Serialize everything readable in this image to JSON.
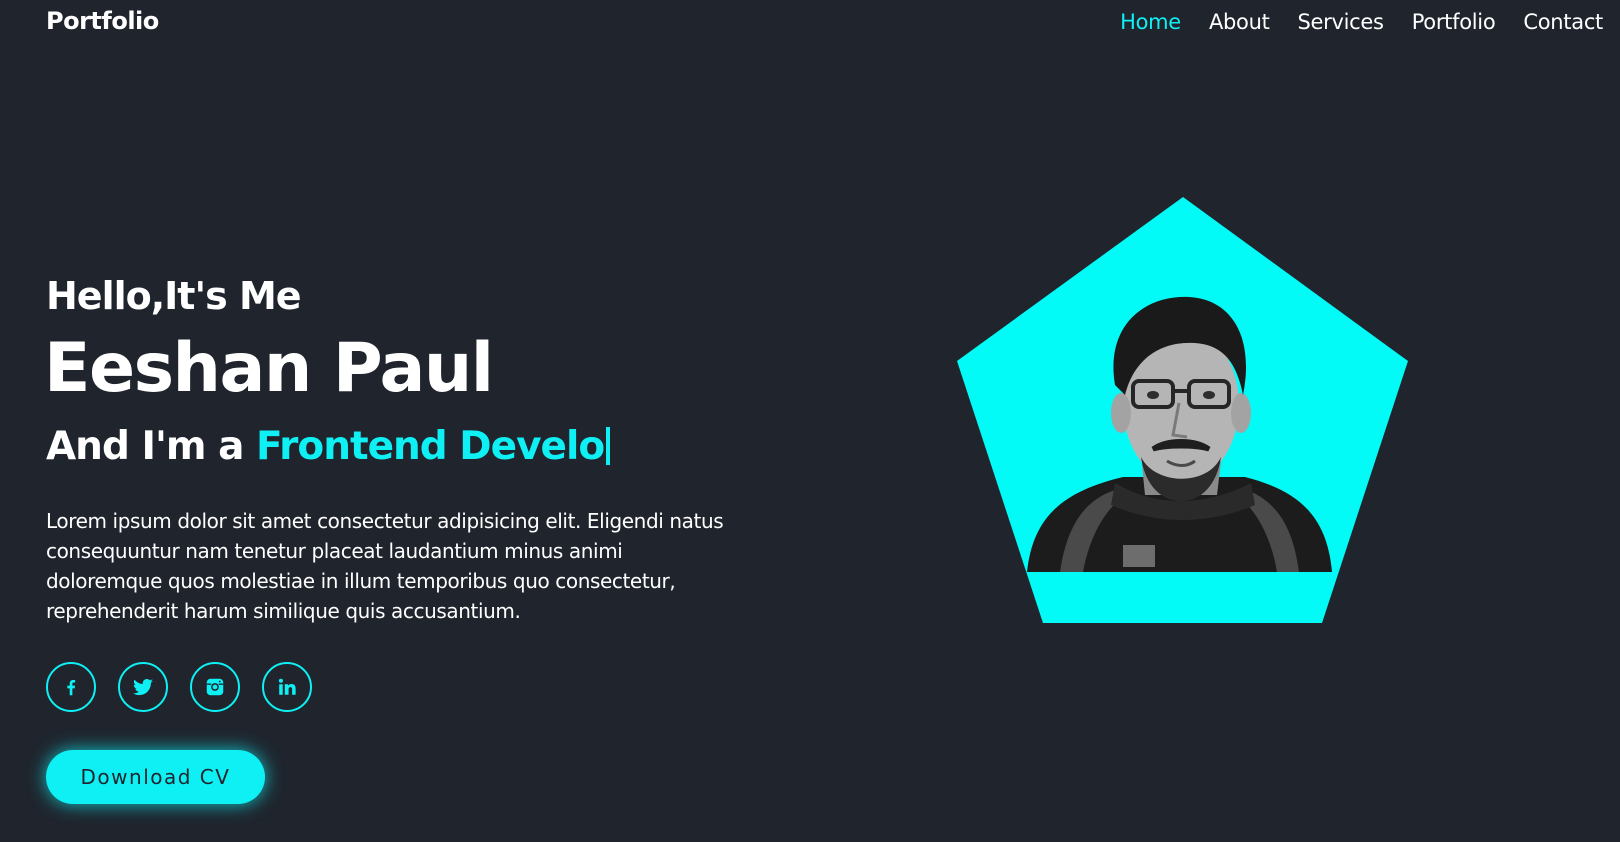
{
  "header": {
    "logo": "Portfolio",
    "nav": [
      {
        "label": "Home",
        "active": true
      },
      {
        "label": "About",
        "active": false
      },
      {
        "label": "Services",
        "active": false
      },
      {
        "label": "Portfolio",
        "active": false
      },
      {
        "label": "Contact",
        "active": false
      }
    ]
  },
  "hero": {
    "greeting": "Hello,It's Me",
    "name": "Eeshan Paul",
    "role_prefix": "And I'm a ",
    "role_typed": "Frontend Develo",
    "description": "Lorem ipsum dolor sit amet consectetur adipisicing elit. Eligendi natus consequuntur nam tenetur placeat laudantium minus animi doloremque quos molestiae in illum temporibus quo consectetur, reprehenderit harum similique quis accusantium.",
    "socials": [
      {
        "icon": "facebook-icon"
      },
      {
        "icon": "twitter-icon"
      },
      {
        "icon": "instagram-icon"
      },
      {
        "icon": "linkedin-icon"
      }
    ],
    "download_label": "Download CV"
  },
  "colors": {
    "background": "#1f242d",
    "accent": "#0ef0f4",
    "text": "#ffffff"
  }
}
